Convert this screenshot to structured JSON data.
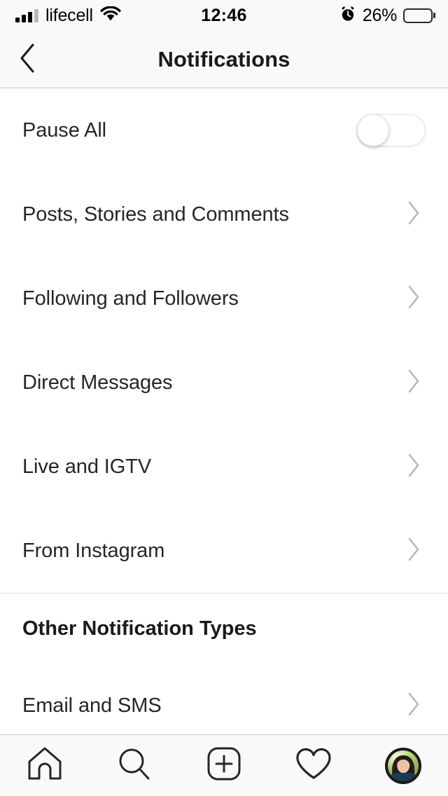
{
  "status_bar": {
    "carrier": "lifecell",
    "time": "12:46",
    "battery_percent": "26%",
    "battery_level": 26,
    "signal_bars_filled": 3,
    "signal_bars_total": 4,
    "icons": {
      "wifi": "wifi-icon",
      "alarm": "alarm-clock-icon",
      "battery": "battery-icon"
    }
  },
  "header": {
    "title": "Notifications",
    "back_icon": "chevron-left-icon"
  },
  "settings": {
    "pause_all": {
      "label": "Pause All",
      "toggle_state": "off"
    },
    "rows": [
      {
        "label": "Posts, Stories and Comments"
      },
      {
        "label": "Following and Followers"
      },
      {
        "label": "Direct Messages"
      },
      {
        "label": "Live and IGTV"
      },
      {
        "label": "From Instagram"
      }
    ],
    "other_section": {
      "title": "Other Notification Types",
      "rows": [
        {
          "label": "Email and SMS"
        }
      ]
    }
  },
  "tab_bar": {
    "items": [
      {
        "name": "home",
        "icon": "home-icon",
        "active": false
      },
      {
        "name": "search",
        "icon": "search-icon",
        "active": false
      },
      {
        "name": "add",
        "icon": "plus-square-icon",
        "active": false
      },
      {
        "name": "activity",
        "icon": "heart-icon",
        "active": false
      },
      {
        "name": "profile",
        "icon": "avatar-icon",
        "active": true
      }
    ]
  },
  "colors": {
    "text_primary": "#262626",
    "text_header": "#1a1a1a",
    "chevron": "#b8b8b8",
    "bar_background": "#f9f9f9",
    "list_background": "#ffffff",
    "divider": "#dcdcdc"
  }
}
